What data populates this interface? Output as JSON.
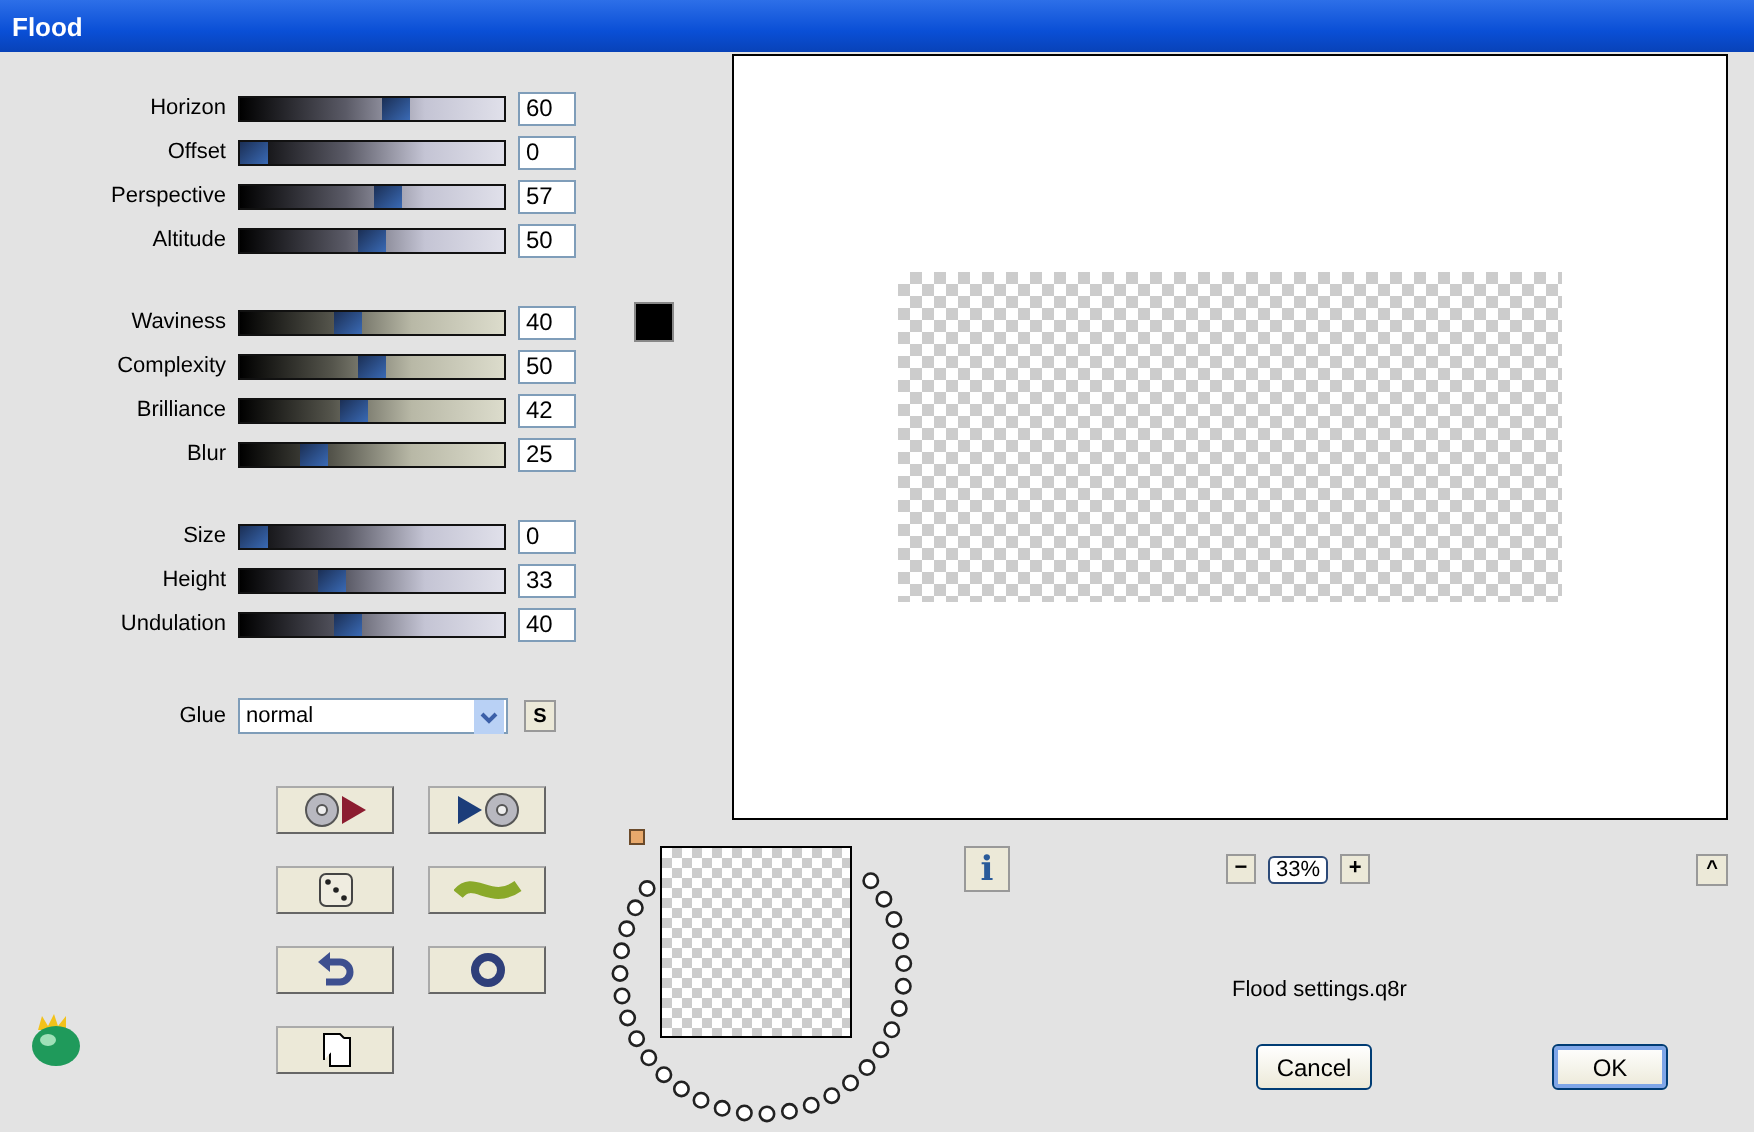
{
  "window": {
    "title": "Flood"
  },
  "slider_groups": [
    {
      "sliders": [
        {
          "label": "Horizon",
          "value": "60",
          "level": 0.6
        },
        {
          "label": "Offset",
          "value": "0",
          "level": 0
        },
        {
          "label": "Perspective",
          "value": "57",
          "level": 0.57
        },
        {
          "label": "Altitude",
          "value": "50",
          "level": 0.5
        }
      ]
    },
    {
      "swatch": {
        "color": "#000000"
      },
      "sliders": [
        {
          "label": "Waviness",
          "value": "40",
          "level": 0.4
        },
        {
          "label": "Complexity",
          "value": "50",
          "level": 0.5
        },
        {
          "label": "Brilliance",
          "value": "42",
          "level": 0.42
        },
        {
          "label": "Blur",
          "value": "25",
          "level": 0.25
        }
      ]
    },
    {
      "sliders": [
        {
          "label": "Size",
          "value": "0",
          "level": 0
        },
        {
          "label": "Height",
          "value": "33",
          "level": 0.33
        },
        {
          "label": "Undulation",
          "value": "40",
          "level": 0.4
        }
      ]
    }
  ],
  "glue": {
    "label": "Glue",
    "value": "normal",
    "side_button": "S"
  },
  "info_button": "i",
  "zoom": {
    "minus": "−",
    "value": "33%",
    "plus": "+"
  },
  "collapse_button": "^",
  "settings_file": "Flood settings.q8r",
  "dialog_buttons": [
    {
      "label": "Cancel",
      "default": false
    },
    {
      "label": "OK",
      "default": true
    }
  ]
}
